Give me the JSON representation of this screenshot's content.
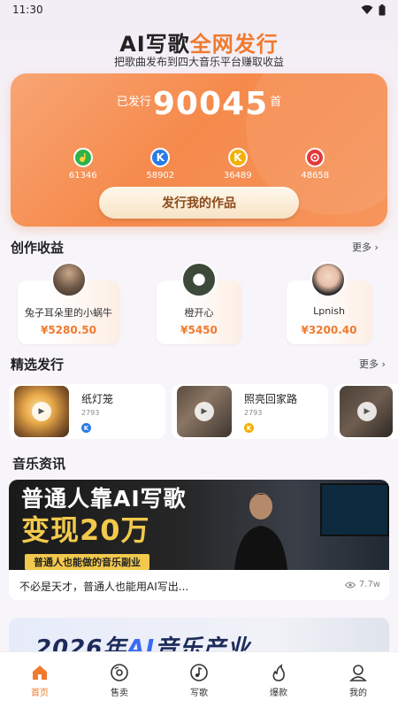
{
  "status_bar": {
    "time": "11:30",
    "icons": [
      "wifi-icon",
      "battery-icon"
    ]
  },
  "hero": {
    "title_part1": "AI写歌",
    "title_part2": "全网发行",
    "subtitle": "把歌曲发布到四大音乐平台赚取收益"
  },
  "stats_card": {
    "prefix": "已发行",
    "count": "90045",
    "suffix": "首",
    "platforms": [
      {
        "icon": "qq-music-icon",
        "count": "61346",
        "color": "#2db34a"
      },
      {
        "icon": "kugou-icon",
        "count": "58902",
        "color": "#2b7be6"
      },
      {
        "icon": "kuwo-icon",
        "count": "36489",
        "color": "#f4b000"
      },
      {
        "icon": "netease-music-icon",
        "count": "48658",
        "color": "#e02a2a"
      }
    ],
    "release_button": "发行我的作品"
  },
  "earnings": {
    "title": "创作收益",
    "more": "更多",
    "items": [
      {
        "name": "兔子耳朵里的小蜗牛",
        "amount": "¥5280.50"
      },
      {
        "name": "橙开心",
        "amount": "¥5450"
      },
      {
        "name": "Lpnish",
        "amount": "¥3200.40"
      }
    ]
  },
  "featured": {
    "title": "精选发行",
    "more": "更多",
    "items": [
      {
        "title": "纸灯笼",
        "count": "2793",
        "badge": "K",
        "badge_color": "#2b7be6"
      },
      {
        "title": "照亮回家路",
        "count": "2793",
        "badge": "K",
        "badge_color": "#f4b000"
      }
    ]
  },
  "news": {
    "title": "音乐资讯",
    "banner_line1": "普通人靠AI写歌",
    "banner_line2": "变现20万",
    "banner_strip": "普通人也能做的音乐副业",
    "caption": "不必是天才，普通人也能用AI写出...",
    "views": "7.7w",
    "banner2_prefix": "2026年",
    "banner2_ai": "AI",
    "banner2_suffix": "音乐产业"
  },
  "tabbar": {
    "items": [
      {
        "label": "首页",
        "icon": "home-icon",
        "active": true
      },
      {
        "label": "售卖",
        "icon": "vinyl-icon",
        "active": false
      },
      {
        "label": "写歌",
        "icon": "music-note-icon",
        "active": false
      },
      {
        "label": "爆款",
        "icon": "flame-icon",
        "active": false
      },
      {
        "label": "我的",
        "icon": "profile-icon",
        "active": false
      }
    ]
  },
  "colors": {
    "accent": "#f07a2e",
    "card_gradient_start": "#f8a574",
    "card_gradient_end": "#f58a4c"
  }
}
